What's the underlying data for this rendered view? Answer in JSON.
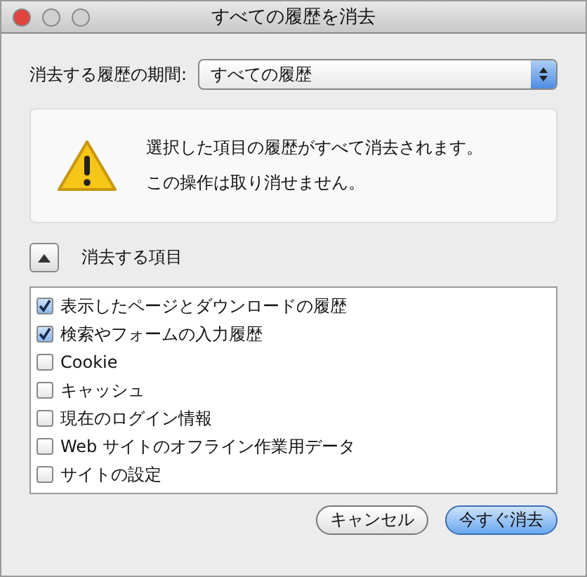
{
  "window": {
    "title": "すべての履歴を消去"
  },
  "period": {
    "label": "消去する履歴の期間:",
    "value": "すべての履歴"
  },
  "warning": {
    "lines": [
      "選択した項目の履歴がすべて消去されます。",
      "この操作は取り消せません。"
    ]
  },
  "details": {
    "label": "消去する項目",
    "expanded": true
  },
  "items": [
    {
      "label": "表示したページとダウンロードの履歴",
      "checked": true
    },
    {
      "label": "検索やフォームの入力履歴",
      "checked": true
    },
    {
      "label": "Cookie",
      "checked": false
    },
    {
      "label": "キャッシュ",
      "checked": false
    },
    {
      "label": "現在のログイン情報",
      "checked": false
    },
    {
      "label": "Web サイトのオフライン作業用データ",
      "checked": false
    },
    {
      "label": "サイトの設定",
      "checked": false
    }
  ],
  "buttons": [
    {
      "label": "キャンセル",
      "default": false
    },
    {
      "label": "今すぐ消去",
      "default": true
    }
  ]
}
